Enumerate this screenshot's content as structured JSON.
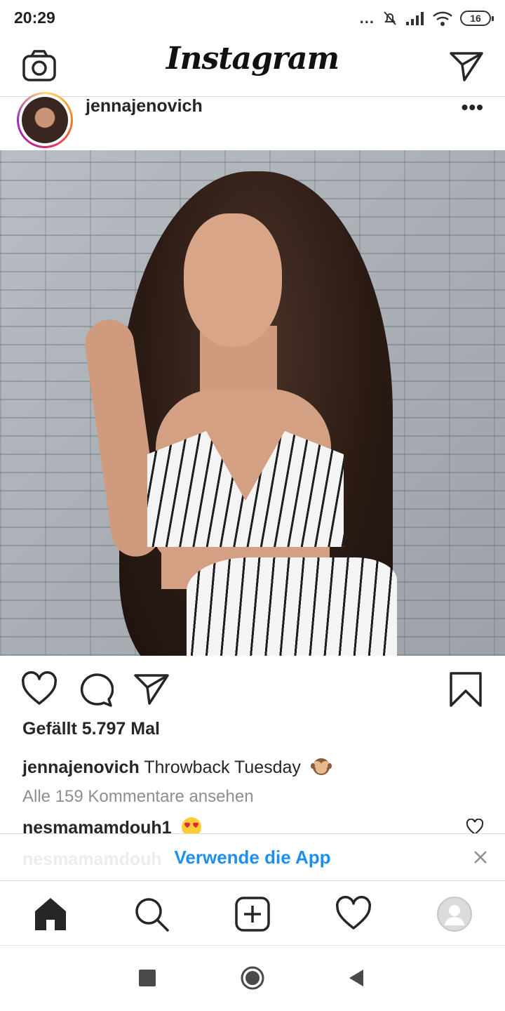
{
  "status_bar": {
    "time": "20:29",
    "dots": "...",
    "battery": "16"
  },
  "header": {
    "brand": "Instagram",
    "icons": [
      "camera-icon",
      "direct-message-icon"
    ]
  },
  "post": {
    "username": "jennajenovich",
    "more_label": "•••",
    "likes_text": "Gefällt 5.797 Mal",
    "caption_user": "jennajenovich",
    "caption_text": "Throwback Tuesday",
    "caption_emoji": "see-no-evil-monkey",
    "view_comments": "Alle 159 Kommentare ansehen",
    "first_comment_user": "nesmamamdouh1",
    "first_comment_emoji": "heart-eyes"
  },
  "app_banner": {
    "ghost_text": "nesmamamdouh",
    "cta": "Verwende die App"
  },
  "bottom_nav": {
    "items": [
      "home",
      "search",
      "new-post",
      "activity",
      "profile"
    ]
  },
  "colors": {
    "link_blue": "#1c8ff0",
    "text_primary": "#262626",
    "text_secondary": "#8e8e8e",
    "divider": "#dbdbdb"
  }
}
